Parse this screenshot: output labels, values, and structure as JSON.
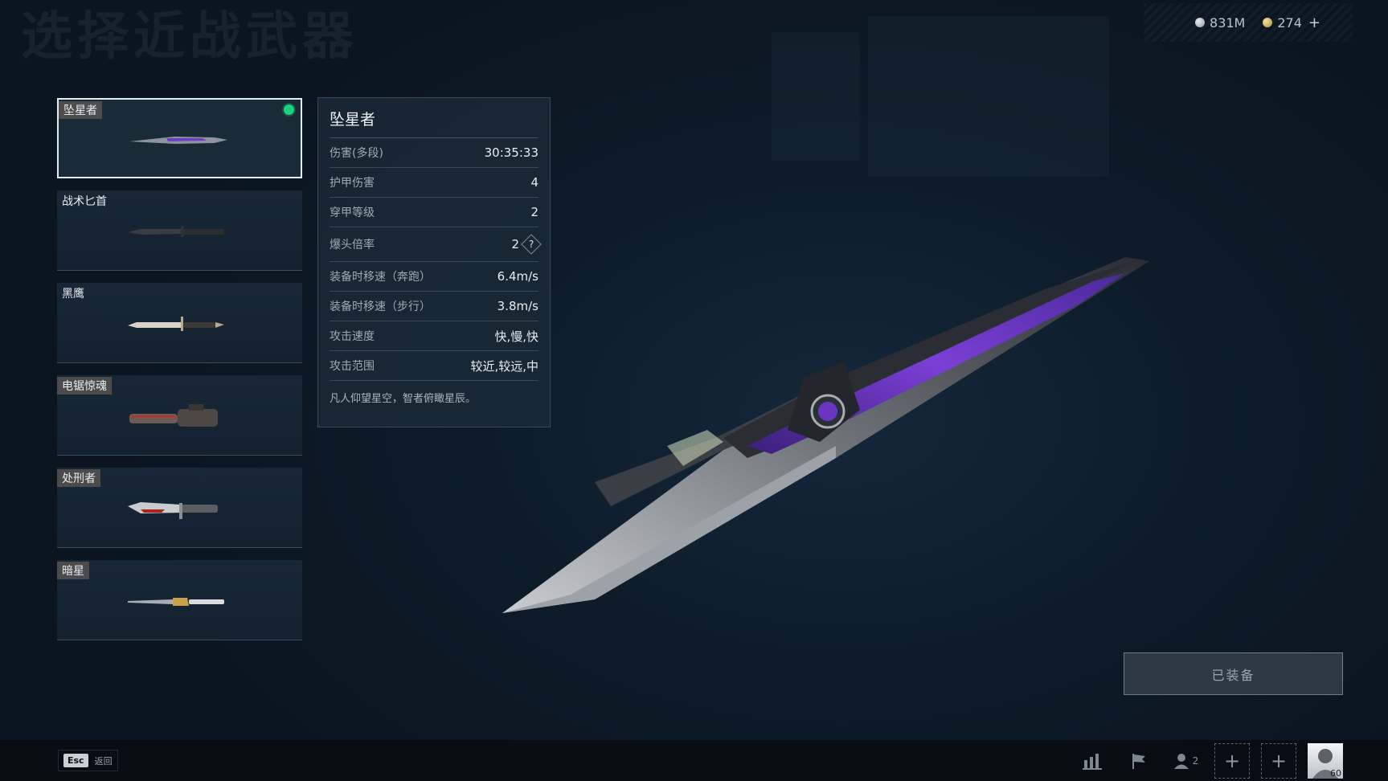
{
  "page": {
    "title": "选择近战武器"
  },
  "currency": [
    {
      "icon": "silver-coin-icon",
      "value": "831M"
    },
    {
      "icon": "gold-coin-icon",
      "value": "274"
    }
  ],
  "weapons": [
    {
      "name": "坠星者",
      "selected": true,
      "equipped": true,
      "tagged": true
    },
    {
      "name": "战术匕首",
      "selected": false,
      "equipped": false,
      "tagged": false
    },
    {
      "name": "黑鹰",
      "selected": false,
      "equipped": false,
      "tagged": false
    },
    {
      "name": "电锯惊魂",
      "selected": false,
      "equipped": false,
      "tagged": true
    },
    {
      "name": "处刑者",
      "selected": false,
      "equipped": false,
      "tagged": true
    },
    {
      "name": "暗星",
      "selected": false,
      "equipped": false,
      "tagged": true
    }
  ],
  "stats": {
    "title": "坠星者",
    "rows": [
      {
        "label": "伤害(多段)",
        "value": "30:35:33"
      },
      {
        "label": "护甲伤害",
        "value": "4"
      },
      {
        "label": "穿甲等级",
        "value": "2"
      },
      {
        "label": "爆头倍率",
        "value": "2",
        "help": "?"
      },
      {
        "label": "装备时移速（奔跑）",
        "value": "6.4m/s"
      },
      {
        "label": "装备时移速（步行）",
        "value": "3.8m/s"
      },
      {
        "label": "攻击速度",
        "value": "快,慢,快"
      },
      {
        "label": "攻击范围",
        "value": "较近,较远,中"
      }
    ],
    "description": "凡人仰望星空，智者俯瞰星辰。"
  },
  "equip_button": {
    "label": "已装备"
  },
  "bottom": {
    "esc_key": "Esc",
    "back_label": "返回",
    "friend_count": "2",
    "slot_plus": "+",
    "avatar_level": "60"
  },
  "colors": {
    "equipped_dot": "#19d27e",
    "accent_purple": "#7b3fd6"
  }
}
